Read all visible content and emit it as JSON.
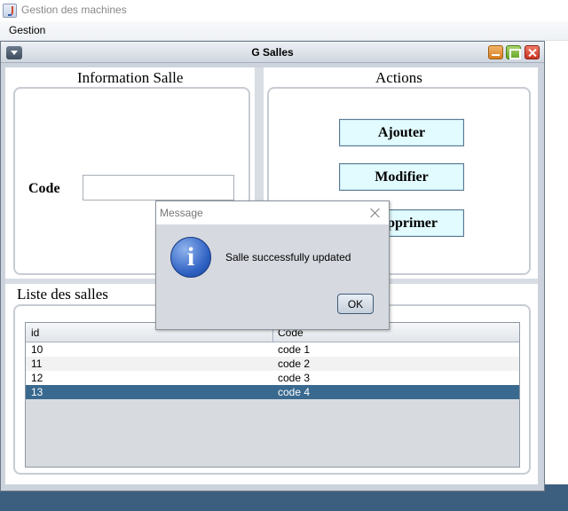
{
  "app": {
    "title": "Gestion des machines",
    "menu": [
      "Gestion"
    ]
  },
  "frame": {
    "title": "G Salles"
  },
  "info_panel": {
    "title": "Information Salle",
    "code_label": "Code",
    "code_value": ""
  },
  "actions_panel": {
    "title": "Actions",
    "buttons": [
      "Ajouter",
      "Modifier",
      "Supprimer"
    ],
    "visible_delete_label": "pprimer"
  },
  "list_panel": {
    "title": "Liste des salles",
    "columns": [
      "id",
      "Code"
    ],
    "rows": [
      {
        "id": "10",
        "code": "code 1"
      },
      {
        "id": "11",
        "code": "code 2"
      },
      {
        "id": "12",
        "code": "code 3"
      },
      {
        "id": "13",
        "code": "code 4",
        "selected": true
      }
    ]
  },
  "dialog": {
    "title": "Message",
    "message": "Salle successfully updated",
    "ok_label": "OK",
    "icon": "information-icon"
  },
  "colors": {
    "selection": "#39698f",
    "action_button_bg": "#e2fbff",
    "desktop": "#3c5f80"
  }
}
